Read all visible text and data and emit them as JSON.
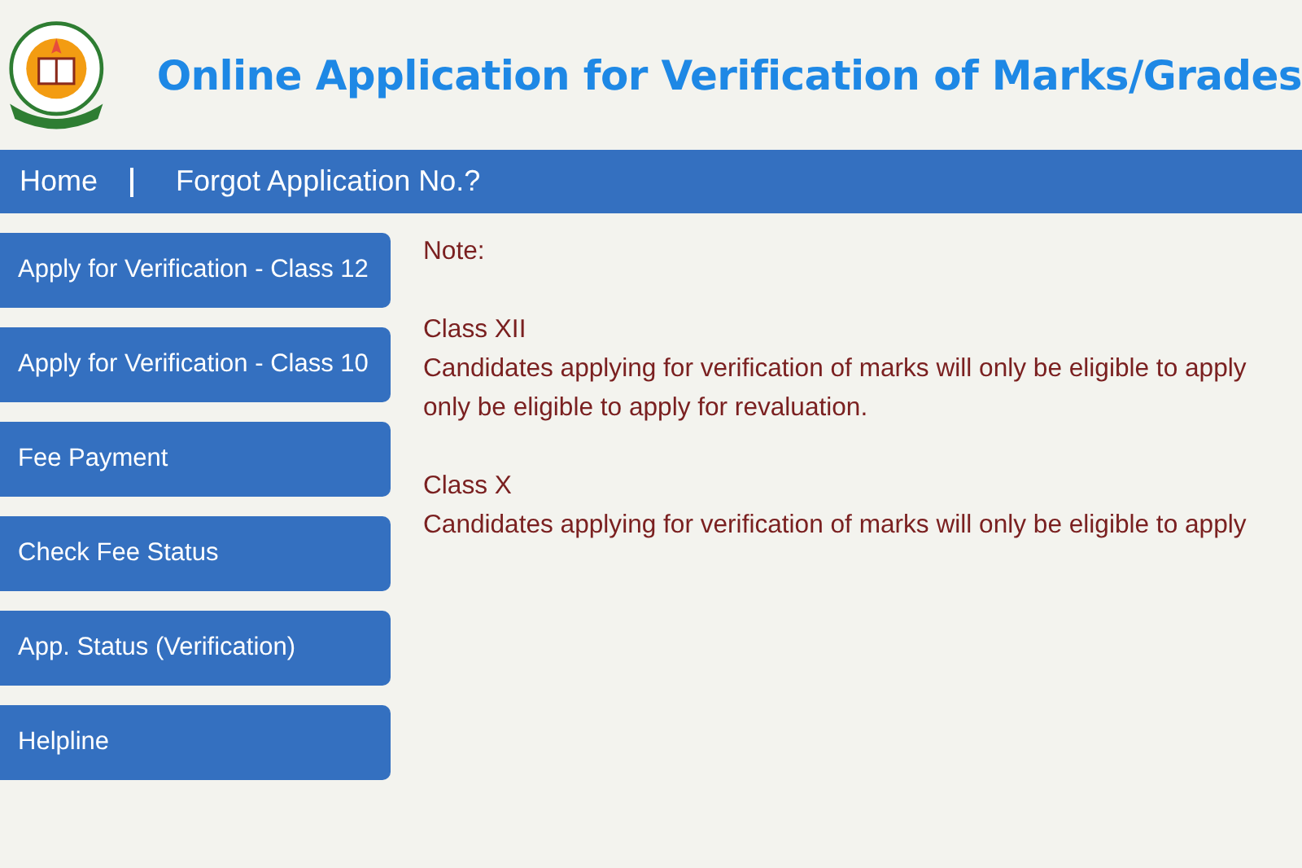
{
  "header": {
    "title": "Online Application for Verification of Marks/Grades"
  },
  "nav": [
    {
      "label": "Home"
    },
    {
      "label": "Forgot Application No.?"
    }
  ],
  "sidebar": {
    "items": [
      {
        "label": "Apply for Verification - Class 12"
      },
      {
        "label": "Apply for Verification - Class 10"
      },
      {
        "label": "Fee Payment"
      },
      {
        "label": "Check Fee Status"
      },
      {
        "label": "App. Status (Verification)"
      },
      {
        "label": "Helpline"
      }
    ]
  },
  "note": {
    "label": "Note:",
    "sections": [
      {
        "heading": "Class XII",
        "lines": [
          "Candidates applying for verification of marks will only be eligible to apply",
          "only be eligible to apply for revaluation."
        ]
      },
      {
        "heading": "Class X",
        "lines": [
          "Candidates applying for verification of marks will only be eligible to apply"
        ]
      }
    ]
  }
}
